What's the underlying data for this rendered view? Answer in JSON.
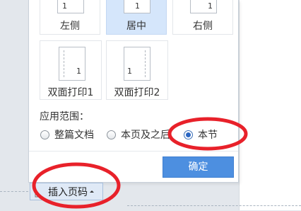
{
  "position_options": [
    {
      "label": "左侧",
      "page_number": "1",
      "selected": false
    },
    {
      "label": "居中",
      "page_number": "1",
      "selected": true
    },
    {
      "label": "右侧",
      "page_number": "1",
      "selected": false
    }
  ],
  "duplex_options": [
    {
      "label": "双面打印1",
      "page_number": "1"
    },
    {
      "label": "双面打印2",
      "page_number": "1"
    }
  ],
  "apply_scope": {
    "title": "应用范围：",
    "options": [
      {
        "label": "整篇文档",
        "checked": false
      },
      {
        "label": "本页及之后",
        "checked": false
      },
      {
        "label": "本节",
        "checked": true
      }
    ]
  },
  "confirm_label": "确定",
  "insert_page_number_label": "插入页码",
  "colors": {
    "accent": "#4d8fe0",
    "selected_bg": "#d5e6fb",
    "annotation_red": "#e8212a"
  }
}
